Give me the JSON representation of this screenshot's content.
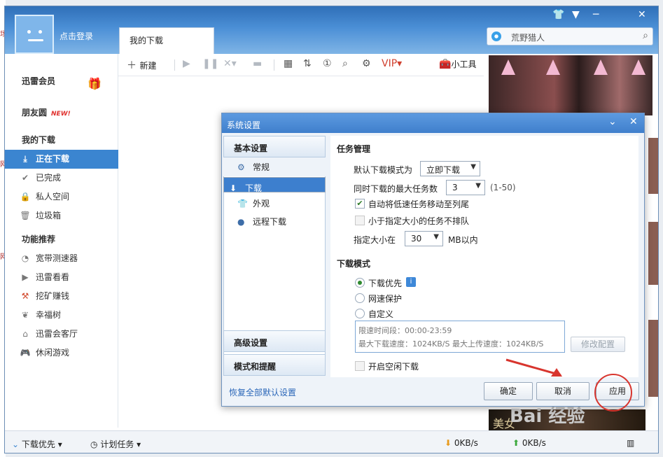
{
  "app": {
    "login_text": "点击登录",
    "tab_label": "我的下载",
    "search_placeholder": "荒野猎人",
    "window_controls": [
      "shirt-icon",
      "menu-icon",
      "minimize-icon",
      "close-icon"
    ]
  },
  "sidebar": {
    "vip": "迅雷会员",
    "friends": "朋友圆",
    "friends_badge": "NEW!",
    "my_downloads_header": "我的下载",
    "download_items": [
      {
        "label": "正在下载",
        "icon": "download-icon",
        "active": true
      },
      {
        "label": "已完成",
        "icon": "check-icon",
        "active": false
      },
      {
        "label": "私人空间",
        "icon": "lock-icon",
        "active": false
      },
      {
        "label": "垃圾箱",
        "icon": "trash-icon",
        "active": false
      }
    ],
    "features_header": "功能推荐",
    "feature_items": [
      {
        "label": "宽带测速器",
        "icon": "speed-icon"
      },
      {
        "label": "迅雷看看",
        "icon": "video-icon"
      },
      {
        "label": "挖矿赚钱",
        "icon": "mining-icon"
      },
      {
        "label": "幸福树",
        "icon": "leaf-icon"
      },
      {
        "label": "迅雷会客厅",
        "icon": "home-icon"
      },
      {
        "label": "休闲游戏",
        "icon": "gamepad-icon"
      }
    ]
  },
  "toolbar": {
    "new_label": "新建",
    "tools_label": "小工具"
  },
  "statusbar": {
    "download_priority": "下载优先",
    "scheduled_tasks": "计划任务",
    "download_speed": "0KB/s",
    "upload_speed": "0KB/s"
  },
  "ad": {
    "bottom_text": "美女",
    "watermark": "Bai 经验",
    "watermark_url": "jingyan.baidu.com"
  },
  "dialog": {
    "title": "系统设置",
    "nav": {
      "basic_settings": "基本设置",
      "items": [
        {
          "label": "常规",
          "icon": "gear-icon",
          "selected": false
        },
        {
          "label": "下载",
          "icon": "download-icon",
          "selected": true
        },
        {
          "label": "外观",
          "icon": "shirt-icon",
          "selected": false
        },
        {
          "label": "远程下载",
          "icon": "remote-icon",
          "selected": false
        }
      ],
      "advanced_settings": "高级设置",
      "mode_and_alerts": "模式和提醒"
    },
    "task_mgmt": {
      "title": "任务管理",
      "default_mode_label": "默认下载模式为",
      "default_mode_value": "立即下载",
      "max_tasks_label": "同时下载的最大任务数",
      "max_tasks_value": "3",
      "max_tasks_range": "(1-50)",
      "auto_move_label": "自动将低速任务移动至列尾",
      "auto_move_checked": true,
      "no_queue_label": "小于指定大小的任务不排队",
      "no_queue_checked": false,
      "size_label": "指定大小在",
      "size_value": "30",
      "size_unit": "MB以内"
    },
    "download_mode": {
      "title": "下载模式",
      "options": [
        {
          "label": "下载优先",
          "selected": true
        },
        {
          "label": "网速保护",
          "selected": false
        },
        {
          "label": "自定义",
          "selected": false
        }
      ],
      "limit_period": "限速时间段：00:00-23:59",
      "limit_speeds": "最大下载速度：1024KB/S  最大上传速度：1024KB/S",
      "edit_config": "修改配置",
      "idle_download_label": "开启空闲下载",
      "idle_download_checked": false
    },
    "restore_defaults": "恢复全部默认设置",
    "buttons": {
      "ok": "确定",
      "cancel": "取消",
      "apply": "应用"
    }
  },
  "colors": {
    "accent": "#3b85d0",
    "annotation": "#d8352e"
  }
}
